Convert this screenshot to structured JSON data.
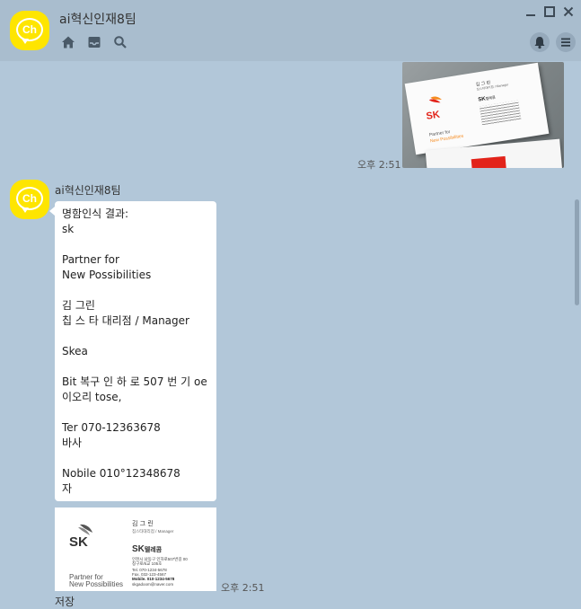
{
  "header": {
    "room_title": "ai혁신인재8팀",
    "avatar_text": "Ch",
    "icons": [
      "home-icon",
      "inbox-icon",
      "search-icon",
      "bell-icon",
      "menu-icon"
    ],
    "window_controls": [
      "minimize-icon",
      "maximize-icon",
      "close-icon"
    ]
  },
  "messages": {
    "sent_image": {
      "time": "오후 2:51",
      "card_name": "김 그 린",
      "card_title": "칭스타대리점 / Manager",
      "brand": "SK",
      "brand_sub": "텔레콤",
      "tagline_1": "Partner for",
      "tagline_2": "New Possibilities"
    },
    "received": {
      "sender": "ai혁신인재8팀",
      "avatar_text": "Ch",
      "ocr_lines": [
        "명함인식 결과:",
        "sk",
        "",
        "Partner for",
        "New Possibilities",
        "",
        "김 그린",
        "칩 스 타 대리점 / Manager",
        "",
        "Skea",
        "",
        "Bit 복구 인 하 로 507 번 기 oe",
        "이오리 tose,",
        "",
        "Ter 070-12363678",
        "바사",
        "",
        "Nobile 010°12348678",
        "자"
      ],
      "card_thumb": {
        "name": "김 그 린",
        "title": "칩스타대리점 / Manager",
        "brand": "SK",
        "brand_sub": "텔레콤",
        "address_1": "인천시 남동구 인하로507번길 00",
        "address_2": "칭구로/6교 105호",
        "tel": "Tel. 070-1234-5678",
        "fax": "Fax. 032-123-4567",
        "mobile": "Mobile. 010-1234-5678",
        "email": "skgadoom@naver.com",
        "tagline_1": "Partner for",
        "tagline_2": "New Possibilities"
      },
      "time": "오후 2:51",
      "save_label": "저장"
    }
  },
  "colors": {
    "background": "#b2c7d9",
    "header": "#a9bdce",
    "avatar": "#fee500",
    "sk_red": "#e2231a",
    "sk_orange": "#f68b1f"
  }
}
